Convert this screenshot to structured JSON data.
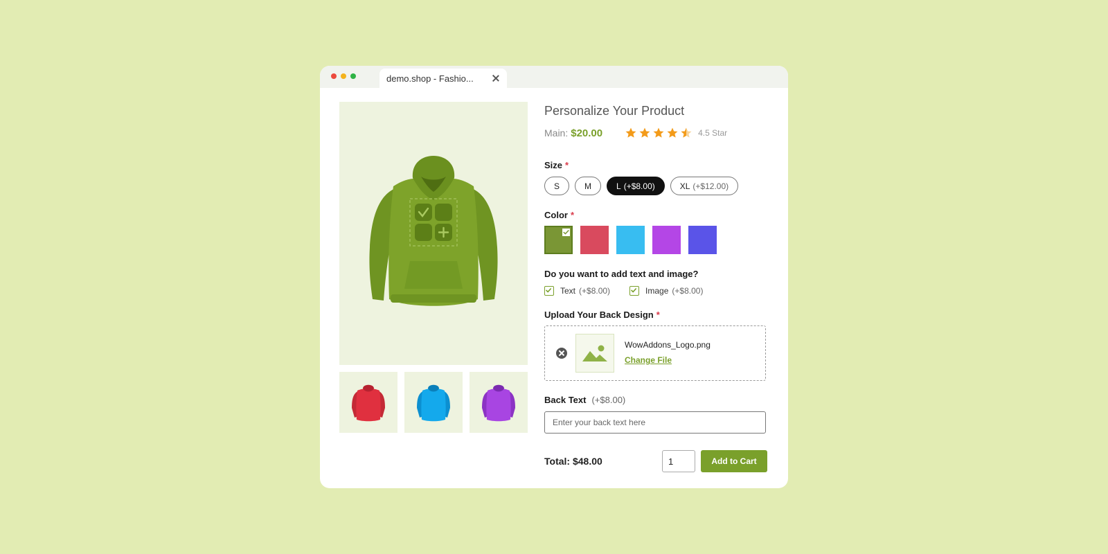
{
  "browser": {
    "tab_title": "demo.shop - Fashio..."
  },
  "product": {
    "title": "Personalize Your Product",
    "price_label": "Main:",
    "price": "$20.00",
    "rating_value": 4.5,
    "rating_text": "4.5 Star"
  },
  "size": {
    "label": "Size",
    "required": "*",
    "options": [
      {
        "name": "S",
        "extra": ""
      },
      {
        "name": "M",
        "extra": ""
      },
      {
        "name": "L",
        "extra": "(+$8.00)"
      },
      {
        "name": "XL",
        "extra": "(+$12.00)"
      }
    ],
    "selected": "L"
  },
  "color": {
    "label": "Color",
    "required": "*",
    "swatches": [
      "#7a9635",
      "#d94a5e",
      "#38bdf1",
      "#b446e6",
      "#5a54e8"
    ],
    "selected_index": 0
  },
  "addons": {
    "question": "Do you want to add text and image?",
    "options": [
      {
        "label": "Text",
        "extra": "(+$8.00)",
        "checked": true
      },
      {
        "label": "Image",
        "extra": "(+$8.00)",
        "checked": true
      }
    ]
  },
  "upload": {
    "label": "Upload Your Back Design",
    "required": "*",
    "file_name": "WowAddons_Logo.png",
    "change_label": "Change File"
  },
  "back_text": {
    "label": "Back Text",
    "extra": "(+$8.00)",
    "placeholder": "Enter your back text here"
  },
  "footer": {
    "total": "Total: $48.00",
    "quantity": "1",
    "add_to_cart": "Add to Cart"
  },
  "gallery": {
    "main_color": "#7ea32a",
    "thumb_colors": [
      "#e0303f",
      "#14a9ec",
      "#a845e2"
    ]
  },
  "theme": {
    "accent": "#7aa02b",
    "star": "#f39b1a"
  }
}
